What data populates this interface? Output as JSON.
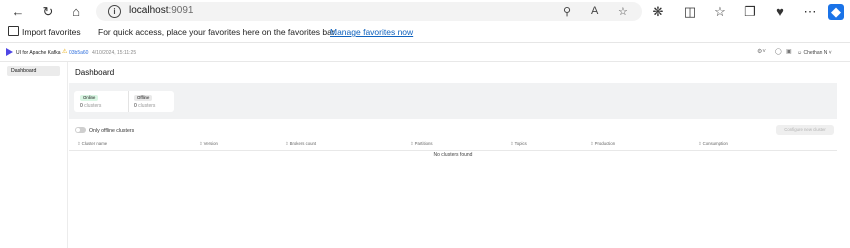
{
  "browser": {
    "url_host": "localhost",
    "url_port": ":9091",
    "favorites_bar": {
      "import_label": "Import favorites",
      "message": "For quick access, place your favorites here on the favorites bar.",
      "manage_link": "Manage favorites now"
    }
  },
  "app": {
    "title": "UI for Apache Kafka",
    "commit": "03b5a60",
    "commit_date": "4/10/2024, 15:11:25",
    "user": "Chethan N"
  },
  "sidebar": {
    "items": [
      {
        "label": "Dashboard"
      }
    ]
  },
  "main": {
    "title": "Dashboard",
    "stats": [
      {
        "badge": "Online",
        "value": "0",
        "unit": "clusters"
      },
      {
        "badge": "Offline",
        "value": "0",
        "unit": "clusters"
      }
    ],
    "toggle_label": "Only offline clusters",
    "configure_button": "Configure new cluster",
    "table": {
      "columns": [
        "Cluster name",
        "Version",
        "Brokers count",
        "Partitions",
        "Topics",
        "Production",
        "Consumption"
      ],
      "empty_text": "No clusters found"
    }
  },
  "colors": {
    "accent": "#4f46e5",
    "link": "#0f62be",
    "online_badge": "#d9f6e3",
    "stats_background": "#f1f2f3"
  }
}
